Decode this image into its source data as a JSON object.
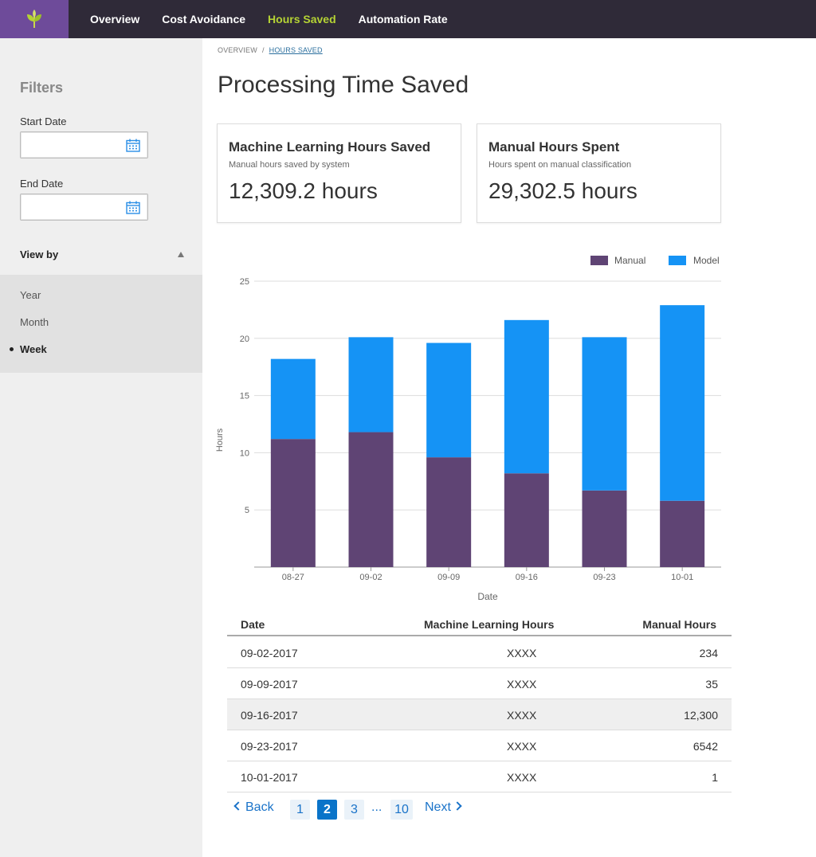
{
  "nav": {
    "items": [
      {
        "label": "Overview",
        "active": false
      },
      {
        "label": "Cost Avoidance",
        "active": false
      },
      {
        "label": "Hours Saved",
        "active": true
      },
      {
        "label": "Automation Rate",
        "active": false
      }
    ],
    "logo_icon": "sprout-icon"
  },
  "sidebar": {
    "title": "Filters",
    "start_label": "Start Date",
    "start_value": "",
    "end_label": "End Date",
    "end_value": "",
    "viewby_label": "View by",
    "options": [
      {
        "label": "Year",
        "selected": false
      },
      {
        "label": "Month",
        "selected": false
      },
      {
        "label": "Week",
        "selected": true
      }
    ]
  },
  "breadcrumb": {
    "root": "OVERVIEW",
    "separator": "/",
    "current": "HOURS SAVED"
  },
  "page": {
    "title": "Processing Time Saved"
  },
  "cards": [
    {
      "title": "Machine Learning Hours Saved",
      "subtitle": "Manual hours saved by system",
      "value": "12,309.2 hours"
    },
    {
      "title": "Manual Hours Spent",
      "subtitle": "Hours spent on manual classification",
      "value": "29,302.5 hours"
    }
  ],
  "chart_data": {
    "type": "bar",
    "stacked": true,
    "categories": [
      "08-27",
      "09-02",
      "09-09",
      "09-16",
      "09-23",
      "10-01"
    ],
    "series": [
      {
        "name": "Manual",
        "color": "#5f4474",
        "values": [
          11.2,
          11.8,
          9.6,
          8.2,
          6.7,
          5.8
        ]
      },
      {
        "name": "Model",
        "color": "#1593f5",
        "values": [
          7.0,
          8.3,
          10.0,
          13.4,
          13.4,
          17.1
        ]
      }
    ],
    "xlabel": "Date",
    "ylabel": "Hours",
    "ylim": [
      0,
      25
    ],
    "yticks": [
      5,
      10,
      15,
      20,
      25
    ],
    "grid": true,
    "legend": "top-right"
  },
  "table": {
    "headers": {
      "date": "Date",
      "ml": "Machine Learning Hours",
      "manual": "Manual Hours"
    },
    "rows": [
      {
        "date": "09-02-2017",
        "ml": "XXXX",
        "manual": "234"
      },
      {
        "date": "09-09-2017",
        "ml": "XXXX",
        "manual": "35"
      },
      {
        "date": "09-16-2017",
        "ml": "XXXX",
        "manual": "12,300"
      },
      {
        "date": "09-23-2017",
        "ml": "XXXX",
        "manual": "6542"
      },
      {
        "date": "10-01-2017",
        "ml": "XXXX",
        "manual": "1"
      }
    ]
  },
  "pager": {
    "back": "Back",
    "next": "Next",
    "pages": [
      "1",
      "2",
      "3",
      "10"
    ],
    "current": "2",
    "ellipsis": "..."
  }
}
